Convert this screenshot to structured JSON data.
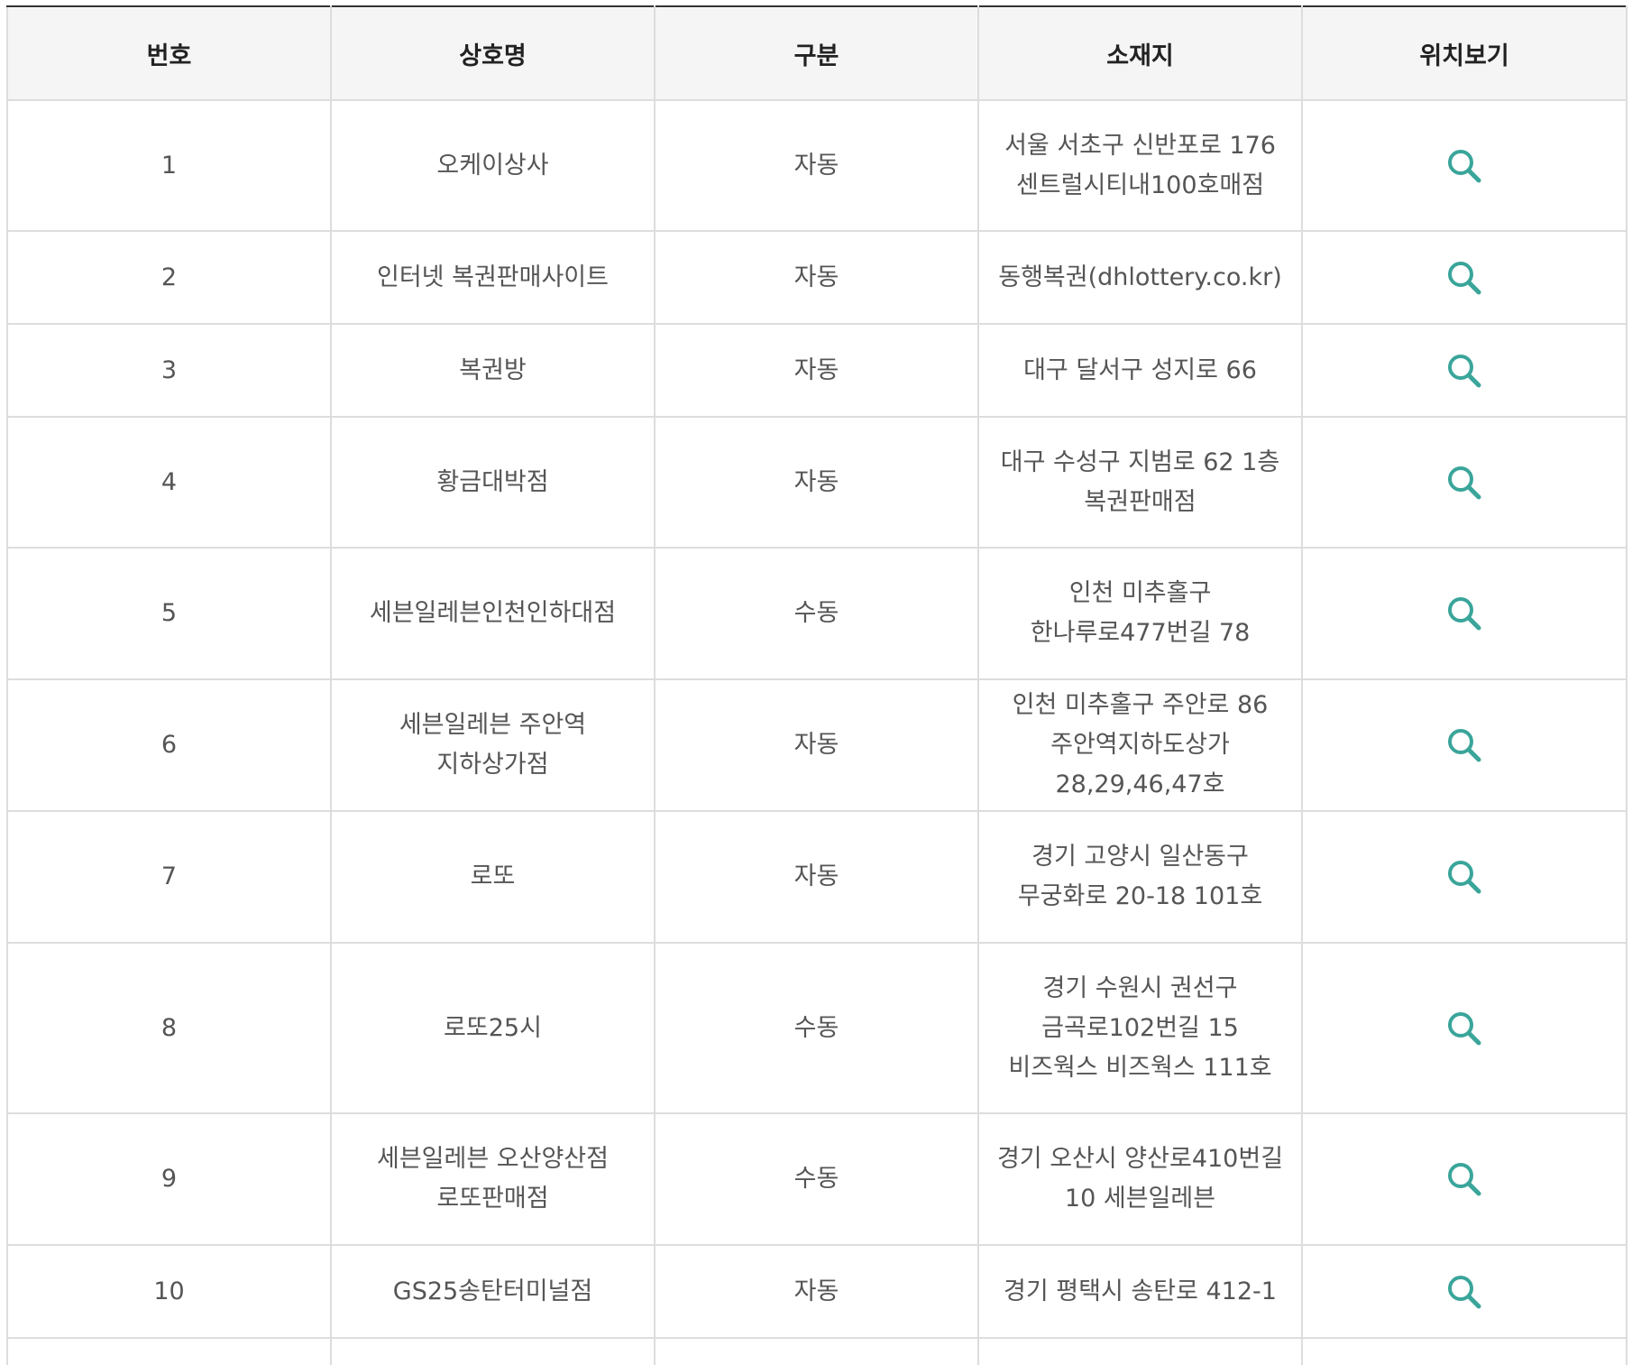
{
  "table": {
    "headers": [
      "번호",
      "상호명",
      "구분",
      "소재지",
      "위치보기"
    ],
    "rows": [
      {
        "no": "1",
        "name": "오케이상사",
        "type": "자동",
        "address": "서울 서초구 신반포로 176 센트럴시티내100호매점"
      },
      {
        "no": "2",
        "name": "인터넷 복권판매사이트",
        "type": "자동",
        "address": "동행복권(dhlottery.co.kr)"
      },
      {
        "no": "3",
        "name": "복권방",
        "type": "자동",
        "address": "대구 달서구 성지로 66"
      },
      {
        "no": "4",
        "name": "황금대박점",
        "type": "자동",
        "address": "대구 수성구 지범로 62 1층 복권판매점"
      },
      {
        "no": "5",
        "name": "세븐일레븐인천인하대점",
        "type": "수동",
        "address": "인천 미추홀구 한나루로477번길 78"
      },
      {
        "no": "6",
        "name": "세븐일레븐 주안역 지하상가점",
        "type": "자동",
        "address": "인천 미추홀구 주안로 86 주안역지하도상가 28,29,46,47호"
      },
      {
        "no": "7",
        "name": "로또",
        "type": "자동",
        "address": "경기 고양시 일산동구 무궁화로 20-18 101호"
      },
      {
        "no": "8",
        "name": "로또25시",
        "type": "수동",
        "address": "경기 수원시 권선구 금곡로102번길 15 비즈웍스 비즈웍스 111호"
      },
      {
        "no": "9",
        "name": "세븐일레븐 오산양산점 로또판매점",
        "type": "수동",
        "address": "경기 오산시 양산로410번길 10 세븐일레븐"
      },
      {
        "no": "10",
        "name": "GS25송탄터미널점",
        "type": "자동",
        "address": "경기 평택시 송탄로 412-1"
      }
    ]
  },
  "icons": {
    "location": "search-icon"
  },
  "colors": {
    "header_bg": "#f5f5f5",
    "header_top_border": "#333333",
    "grid": "#dddddd",
    "icon": "#3aa59a",
    "text": "#555555"
  }
}
